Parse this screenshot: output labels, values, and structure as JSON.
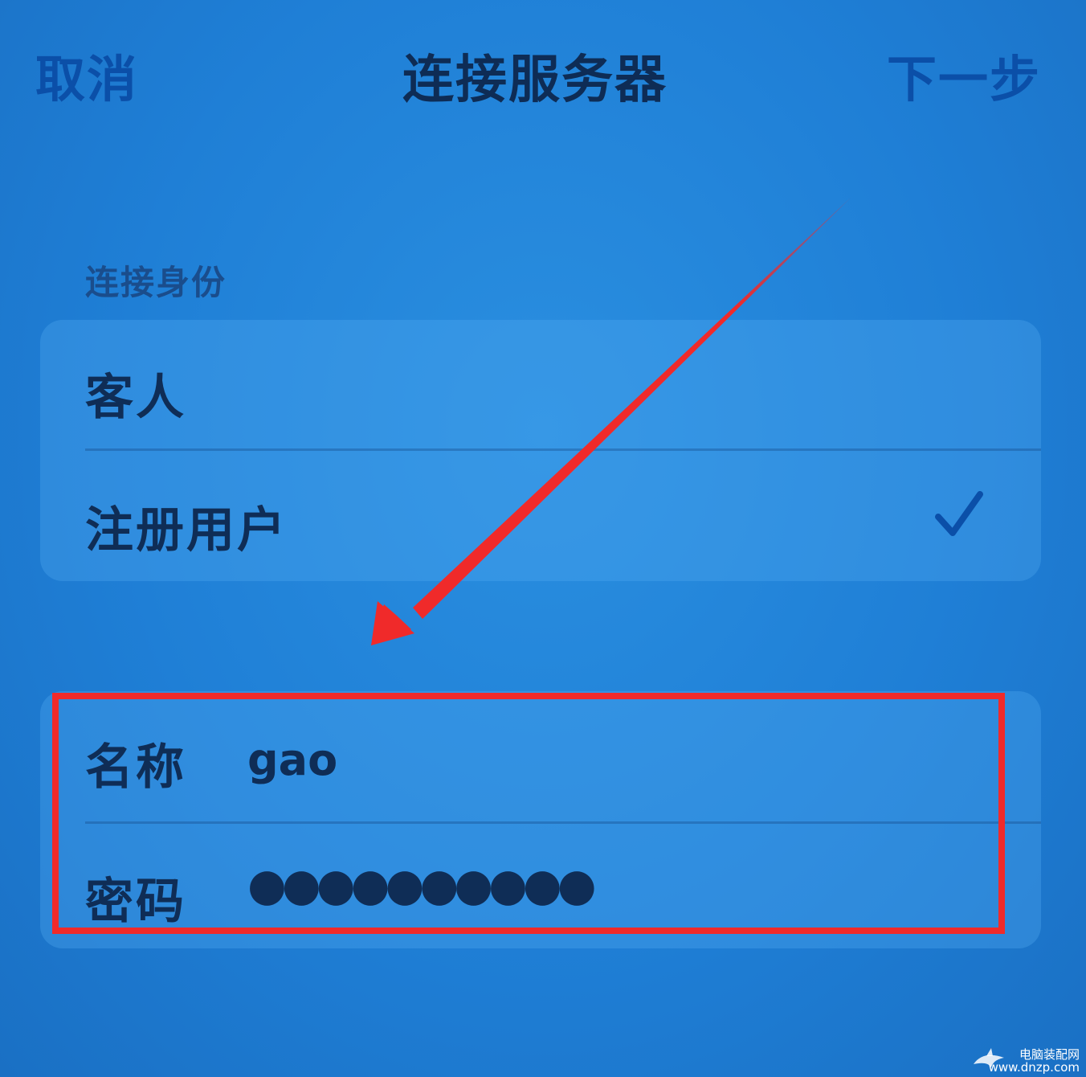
{
  "nav": {
    "cancel_label": "取消",
    "title": "连接服务器",
    "next_label": "下一步"
  },
  "identity": {
    "header": "连接身份",
    "options": [
      {
        "label": "客人",
        "selected": false
      },
      {
        "label": "注册用户",
        "selected": true
      }
    ]
  },
  "credentials": {
    "name_label": "名称",
    "name_value": "gao",
    "password_label": "密码",
    "password_value": "●●●●●●●●●●"
  },
  "annotation": {
    "color": "#f02a2a"
  },
  "watermark": {
    "line1": "电脑装配网",
    "line2": "www.dnzp.com"
  },
  "icons": {
    "selected_indicator": "checkmark-icon",
    "annotation_pointer": "arrow-icon",
    "watermark_logo": "shark-icon"
  }
}
